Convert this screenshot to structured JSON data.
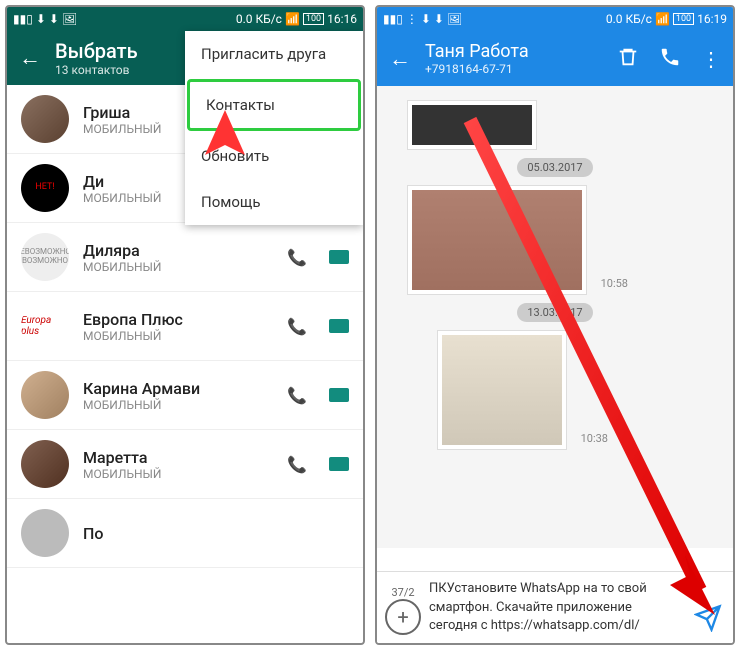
{
  "left": {
    "status": {
      "net": "0.0 КБ/с",
      "batt": "100",
      "time": "16:16"
    },
    "header": {
      "title": "Выбрать",
      "sub": "13 контактов"
    },
    "menu": {
      "invite": "Пригласить друга",
      "contacts": "Контакты",
      "refresh": "Обновить",
      "help": "Помощь"
    },
    "contacts": [
      {
        "name": "Гриша",
        "sub": "МОБИЛЬНЫЙ"
      },
      {
        "name": "Ди",
        "sub": "МОБИЛЬНЫЙ"
      },
      {
        "name": "Диляра",
        "sub": "МОБИЛЬНЫЙ"
      },
      {
        "name": "Европа Плюс",
        "sub": "МОБИЛЬНЫЙ"
      },
      {
        "name": "Карина Армави",
        "sub": "МОБИЛЬНЫЙ"
      },
      {
        "name": "Маретта",
        "sub": "МОБИЛЬНЫЙ"
      },
      {
        "name": "По",
        "sub": ""
      }
    ],
    "av2_text": "НЕТ!",
    "av3_text": "НЕВОЗМОЖНОЕ ВОЗМОЖНО",
    "av4_text": "Europa plus"
  },
  "right": {
    "status": {
      "net": "0.0 КБ/с",
      "batt": "100",
      "time": "16:19"
    },
    "header": {
      "title": "Таня Работа",
      "sub": "+7918164-67-71"
    },
    "dates": {
      "d1": "05.03.2017",
      "d2": "13.03.2017"
    },
    "times": {
      "t1": "10:58",
      "t2": "10:38"
    },
    "compose": {
      "count": "37/2",
      "text": "ПКУстановите WhatsApp на то свой смартфон. Скачайте приложение сегодня с https://whatsapp.com/dl/"
    }
  }
}
